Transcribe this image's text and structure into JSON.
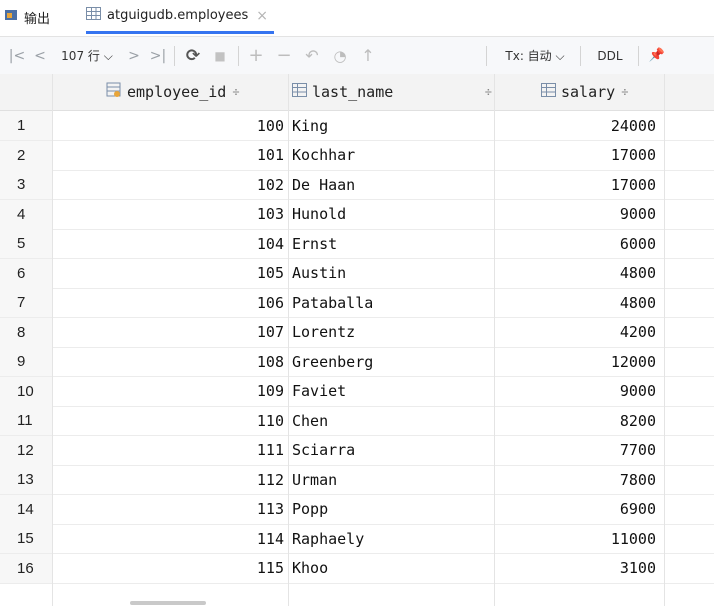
{
  "tabs": [
    {
      "label": "输出",
      "icon": "output-icon"
    },
    {
      "label": "atguigudb.employees",
      "icon": "table-icon",
      "close": "×"
    }
  ],
  "toolbar": {
    "first": "|<",
    "prev": "<",
    "row_count": "107 行 ⌵",
    "next": ">",
    "last": ">|",
    "refresh": "⟳",
    "stop": "■",
    "add": "+",
    "remove": "−",
    "revert": "↶",
    "preview": "◔",
    "submit": "↑",
    "tx_mode": "Tx: 自动 ⌵",
    "ddl": "DDL",
    "pin": "📌"
  },
  "grid": {
    "columns": [
      {
        "label": "employee_id",
        "sort": "÷",
        "icon": "key-column-icon"
      },
      {
        "label": "last_name",
        "sort": "÷",
        "icon": "column-icon"
      },
      {
        "label": "salary",
        "sort": "÷",
        "icon": "column-icon"
      }
    ],
    "rows": [
      {
        "n": "1",
        "employee_id": "100",
        "last_name": "King",
        "salary": "24000"
      },
      {
        "n": "2",
        "employee_id": "101",
        "last_name": "Kochhar",
        "salary": "17000"
      },
      {
        "n": "3",
        "employee_id": "102",
        "last_name": "De Haan",
        "salary": "17000"
      },
      {
        "n": "4",
        "employee_id": "103",
        "last_name": "Hunold",
        "salary": "9000"
      },
      {
        "n": "5",
        "employee_id": "104",
        "last_name": "Ernst",
        "salary": "6000"
      },
      {
        "n": "6",
        "employee_id": "105",
        "last_name": "Austin",
        "salary": "4800"
      },
      {
        "n": "7",
        "employee_id": "106",
        "last_name": "Pataballa",
        "salary": "4800"
      },
      {
        "n": "8",
        "employee_id": "107",
        "last_name": "Lorentz",
        "salary": "4200"
      },
      {
        "n": "9",
        "employee_id": "108",
        "last_name": "Greenberg",
        "salary": "12000"
      },
      {
        "n": "10",
        "employee_id": "109",
        "last_name": "Faviet",
        "salary": "9000"
      },
      {
        "n": "11",
        "employee_id": "110",
        "last_name": "Chen",
        "salary": "8200"
      },
      {
        "n": "12",
        "employee_id": "111",
        "last_name": "Sciarra",
        "salary": "7700"
      },
      {
        "n": "13",
        "employee_id": "112",
        "last_name": "Urman",
        "salary": "7800"
      },
      {
        "n": "14",
        "employee_id": "113",
        "last_name": "Popp",
        "salary": "6900"
      },
      {
        "n": "15",
        "employee_id": "114",
        "last_name": "Raphaely",
        "salary": "11000"
      },
      {
        "n": "16",
        "employee_id": "115",
        "last_name": "Khoo",
        "salary": "3100"
      }
    ]
  }
}
